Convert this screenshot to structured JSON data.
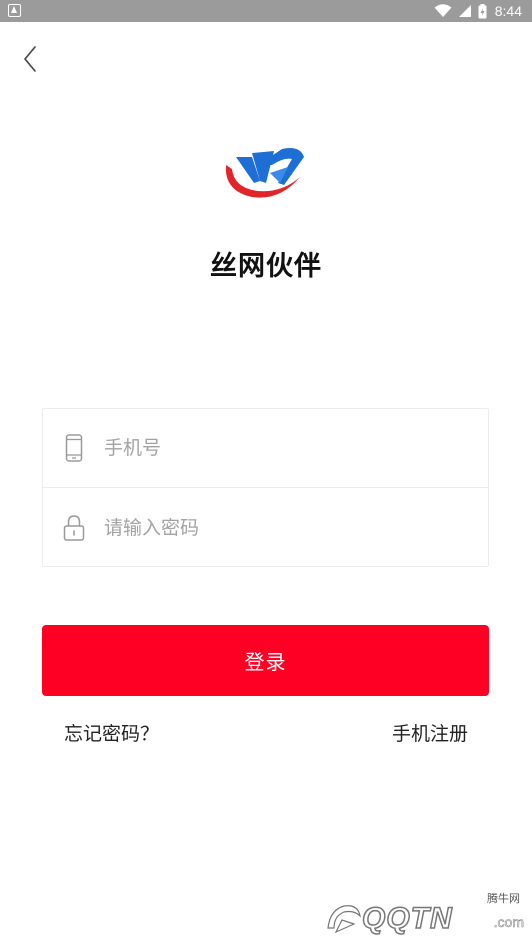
{
  "status_bar": {
    "time": "8:44"
  },
  "header": {
    "back_icon": "chevron-left-icon"
  },
  "app": {
    "name": "丝网伙伴"
  },
  "form": {
    "phone_placeholder": "手机号",
    "phone_value": "",
    "password_placeholder": "请输入密码",
    "password_value": "",
    "phone_icon": "phone-icon",
    "lock_icon": "lock-icon"
  },
  "actions": {
    "login_label": "登录",
    "forgot_label": "忘记密码？",
    "register_label": "手机注册"
  },
  "colors": {
    "accent": "#ff0025",
    "status_bar": "#9b9b9b",
    "logo_blue": "#1d6fd6",
    "logo_red": "#e0262b"
  },
  "watermark": {
    "small_text": "腾牛网",
    "big_text": "QQTN",
    "domain_text": ".com"
  }
}
